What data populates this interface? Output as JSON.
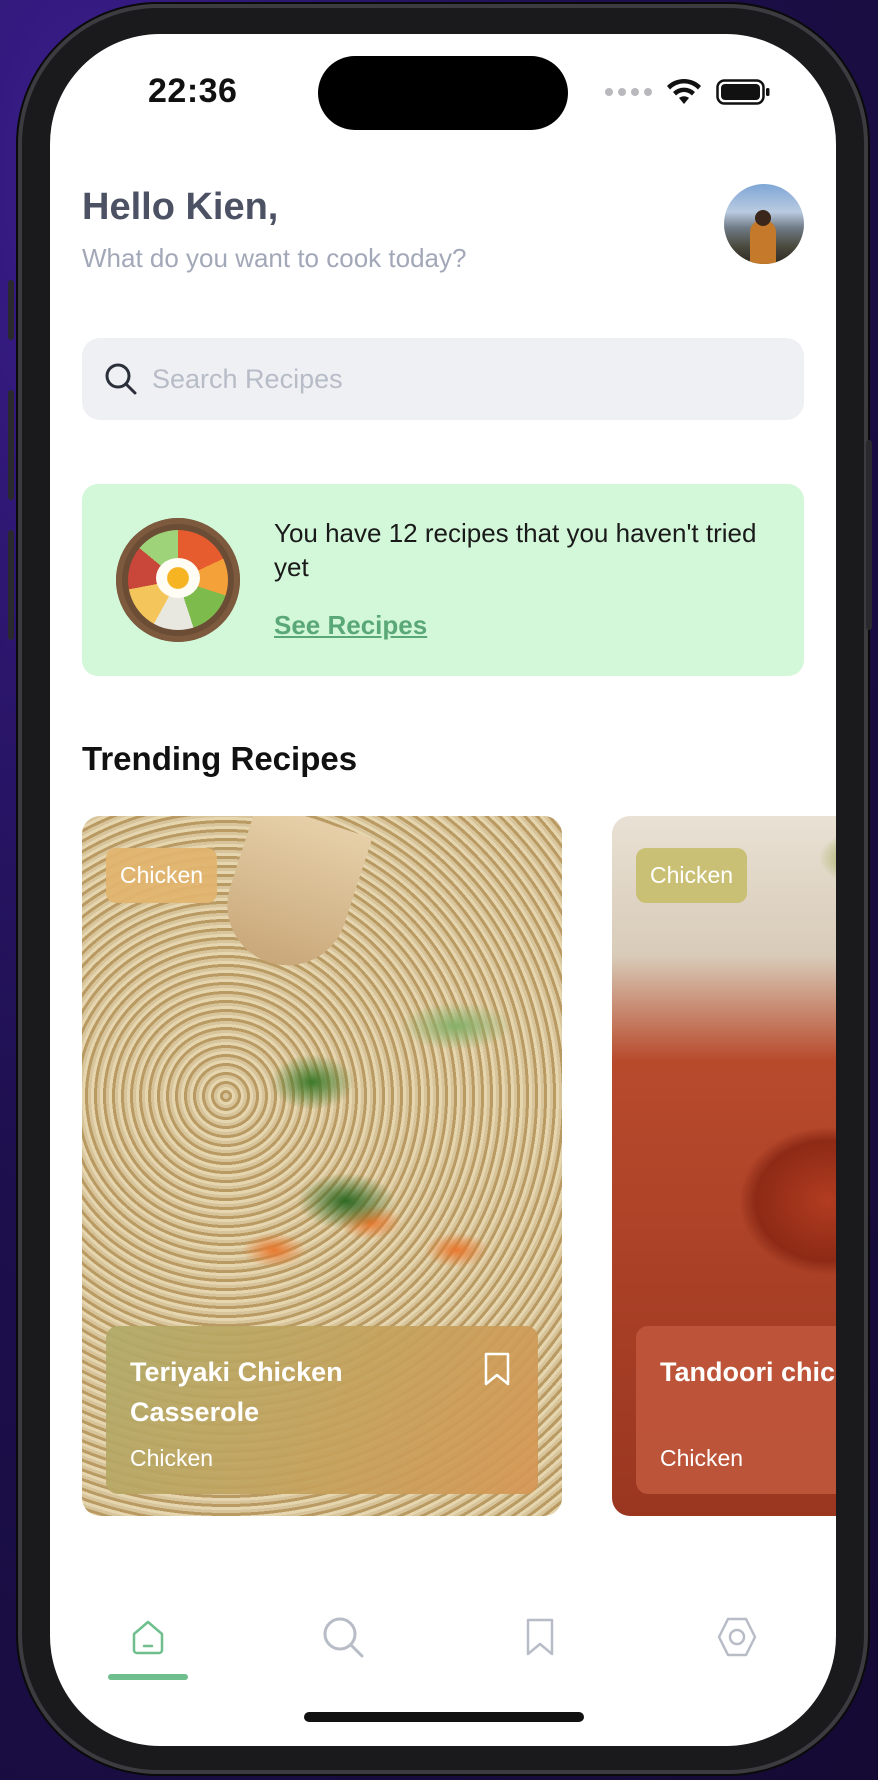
{
  "status_bar": {
    "time": "22:36"
  },
  "header": {
    "greeting": "Hello Kien,",
    "subtitle": "What do you want to cook today?"
  },
  "search": {
    "placeholder": "Search Recipes"
  },
  "banner": {
    "text": "You have 12 recipes that you haven't tried yet",
    "link": "See Recipes"
  },
  "trending": {
    "title": "Trending Recipes",
    "cards": [
      {
        "tag": "Chicken",
        "title": "Teriyaki Chicken Casserole",
        "category": "Chicken"
      },
      {
        "tag": "Chicken",
        "title": "Tandoori chicken",
        "category": "Chicken"
      }
    ]
  },
  "nav": {
    "items": [
      "home-icon",
      "search-icon",
      "bookmark-icon",
      "settings-icon"
    ],
    "active": "home-icon",
    "accent": "#6fbf8e"
  },
  "colors": {
    "banner_bg": "#d3f7d9",
    "link": "#5aa877",
    "search_bg": "#eef0f4"
  }
}
